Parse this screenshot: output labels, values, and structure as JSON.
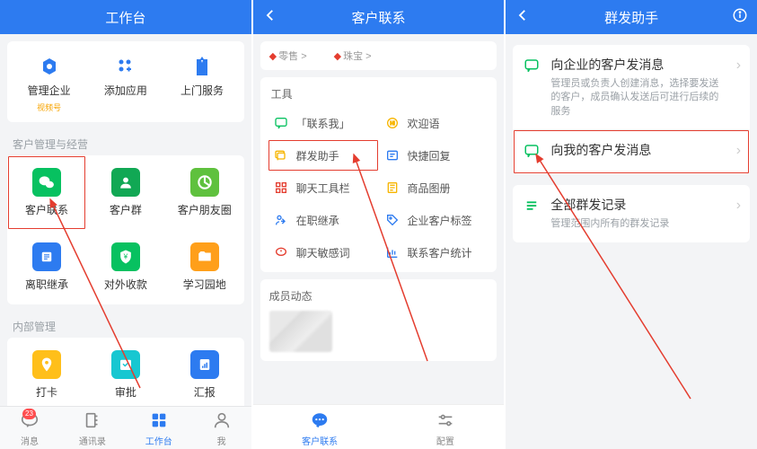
{
  "phone1": {
    "header": "工作台",
    "topRow": [
      {
        "label": "管理企业",
        "sub": "视频号",
        "color": "#2d7bf0",
        "icon": "gear"
      },
      {
        "label": "添加应用",
        "sub": "",
        "color": "#2d7bf0",
        "icon": "plus-grid"
      },
      {
        "label": "上门服务",
        "sub": "",
        "color": "#2d7bf0",
        "icon": "suit"
      }
    ],
    "section1": {
      "title": "客户管理与经营",
      "items": [
        {
          "label": "客户联系",
          "cls": "green",
          "icon": "wechat",
          "highlighted": true
        },
        {
          "label": "客户群",
          "cls": "darkgreen",
          "icon": "group"
        },
        {
          "label": "客户朋友圈",
          "cls": "lime",
          "icon": "moments"
        },
        {
          "label": "离职继承",
          "cls": "blue",
          "icon": "list"
        },
        {
          "label": "对外收款",
          "cls": "green",
          "icon": "shield-yen"
        },
        {
          "label": "学习园地",
          "cls": "orange",
          "icon": "folder"
        }
      ]
    },
    "section2": {
      "title": "内部管理",
      "items": [
        {
          "label": "打卡",
          "cls": "yellow",
          "icon": "pin"
        },
        {
          "label": "审批",
          "cls": "cyan",
          "icon": "calendar"
        },
        {
          "label": "汇报",
          "cls": "blue",
          "icon": "report"
        }
      ]
    },
    "nav": [
      {
        "label": "消息",
        "badge": "23",
        "icon": "chat"
      },
      {
        "label": "通讯录",
        "icon": "contacts"
      },
      {
        "label": "工作台",
        "active": true,
        "icon": "grid"
      },
      {
        "label": "我",
        "icon": "person"
      }
    ]
  },
  "phone2": {
    "header": "客户联系",
    "crumbs": [
      "零售 >",
      "珠宝 >"
    ],
    "toolsTitle": "工具",
    "tools": [
      {
        "label": "「联系我」",
        "color": "#07c160",
        "icon": "chat-sq"
      },
      {
        "label": "欢迎语",
        "color": "#f7b500",
        "icon": "hi"
      },
      {
        "label": "群发助手",
        "color": "#f7b500",
        "icon": "broadcast",
        "highlighted": true
      },
      {
        "label": "快捷回复",
        "color": "#2d7bf0",
        "icon": "reply"
      },
      {
        "label": "聊天工具栏",
        "color": "#e43d2f",
        "icon": "toolbar"
      },
      {
        "label": "商品图册",
        "color": "#f7b500",
        "icon": "catalog"
      },
      {
        "label": "在职继承",
        "color": "#2d7bf0",
        "icon": "inherit"
      },
      {
        "label": "企业客户标签",
        "color": "#2d7bf0",
        "icon": "tag"
      },
      {
        "label": "聊天敏感词",
        "color": "#e43d2f",
        "icon": "alert"
      },
      {
        "label": "联系客户统计",
        "color": "#2d7bf0",
        "icon": "stats"
      }
    ],
    "membersTitle": "成员动态",
    "nav": [
      {
        "label": "客户联系",
        "active": true,
        "icon": "chat-round"
      },
      {
        "label": "配置",
        "icon": "sliders"
      }
    ]
  },
  "phone3": {
    "header": "群发助手",
    "rows": [
      {
        "title": "向企业的客户发消息",
        "desc": "管理员或负责人创建消息，选择要发送的客户，成员确认发送后可进行后续的服务",
        "iconColor": "#07c160",
        "icon": "chat-out"
      },
      {
        "title": "向我的客户发消息",
        "desc": "",
        "iconColor": "#07c160",
        "icon": "chat-out",
        "highlighted": true
      }
    ],
    "logRow": {
      "title": "全部群发记录",
      "desc": "管理范围内所有的群发记录",
      "iconColor": "#07c160",
      "icon": "list-lines"
    }
  }
}
